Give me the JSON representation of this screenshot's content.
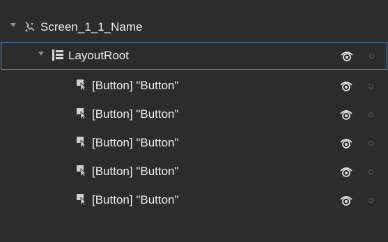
{
  "tree": {
    "items": [
      {
        "label": "Screen_1_1_Name",
        "icon": "user-control-icon",
        "expanded": true,
        "selected": false,
        "show_visibility": false
      },
      {
        "label": "LayoutRoot",
        "icon": "grid-icon",
        "expanded": true,
        "selected": true,
        "show_visibility": true
      },
      {
        "label": "[Button] \"Button\"",
        "icon": "button-icon",
        "expanded": false,
        "selected": false,
        "show_visibility": true
      },
      {
        "label": "[Button] \"Button\"",
        "icon": "button-icon",
        "expanded": false,
        "selected": false,
        "show_visibility": true
      },
      {
        "label": "[Button] \"Button\"",
        "icon": "button-icon",
        "expanded": false,
        "selected": false,
        "show_visibility": true
      },
      {
        "label": "[Button] \"Button\"",
        "icon": "button-icon",
        "expanded": false,
        "selected": false,
        "show_visibility": true
      },
      {
        "label": "[Button] \"Button\"",
        "icon": "button-icon",
        "expanded": false,
        "selected": false,
        "show_visibility": true
      }
    ]
  },
  "colors": {
    "background": "#2c2c2c",
    "selection_border": "#4e86c2",
    "text": "#eeeeee"
  }
}
